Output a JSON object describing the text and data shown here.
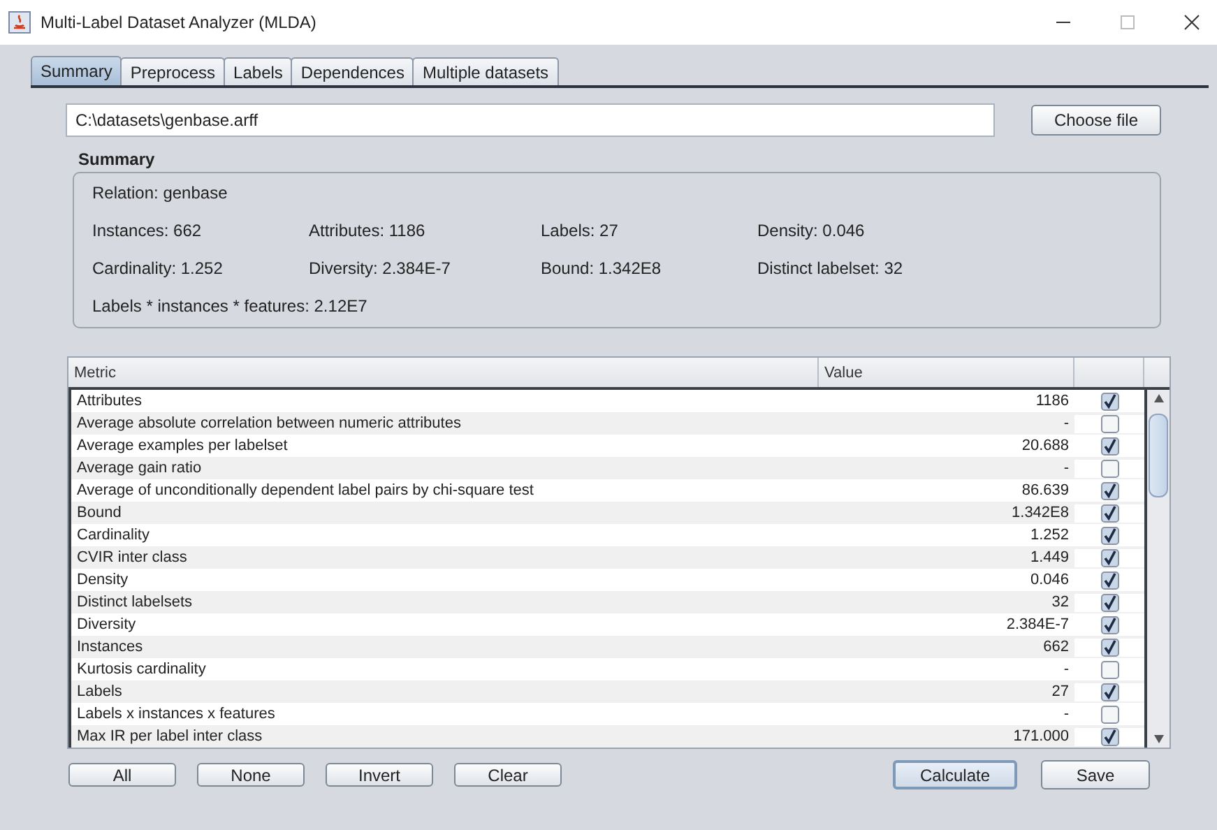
{
  "window": {
    "title": "Multi-Label Dataset Analyzer (MLDA)"
  },
  "tabs": [
    {
      "label": "Summary",
      "selected": true
    },
    {
      "label": "Preprocess",
      "selected": false
    },
    {
      "label": "Labels",
      "selected": false
    },
    {
      "label": "Dependences",
      "selected": false
    },
    {
      "label": "Multiple datasets",
      "selected": false
    }
  ],
  "file": {
    "value": "C:\\datasets\\genbase.arff",
    "button": "Choose file"
  },
  "summary": {
    "title": "Summary",
    "relation": "Relation:  genbase",
    "grid": [
      [
        "Instances:  662",
        "Attributes:  1186",
        "Labels:  27",
        "Density:  0.046"
      ],
      [
        "Cardinality:  1.252",
        "Diversity:  2.384E-7",
        "Bound:  1.342E8",
        "Distinct labelset:  32"
      ]
    ],
    "footer": "Labels * instances * features:  2.12E7"
  },
  "table": {
    "columns": [
      "Metric",
      "Value"
    ],
    "rows": [
      {
        "metric": "Attributes",
        "value": "1186",
        "checked": true
      },
      {
        "metric": "Average absolute correlation between numeric attributes",
        "value": "-",
        "checked": false
      },
      {
        "metric": "Average examples per labelset",
        "value": "20.688",
        "checked": true
      },
      {
        "metric": "Average gain ratio",
        "value": "-",
        "checked": false
      },
      {
        "metric": "Average of unconditionally dependent label pairs by chi-square test",
        "value": "86.639",
        "checked": true
      },
      {
        "metric": "Bound",
        "value": "1.342E8",
        "checked": true
      },
      {
        "metric": "Cardinality",
        "value": "1.252",
        "checked": true
      },
      {
        "metric": "CVIR inter class",
        "value": "1.449",
        "checked": true
      },
      {
        "metric": "Density",
        "value": "0.046",
        "checked": true
      },
      {
        "metric": "Distinct labelsets",
        "value": "32",
        "checked": true
      },
      {
        "metric": "Diversity",
        "value": "2.384E-7",
        "checked": true
      },
      {
        "metric": "Instances",
        "value": "662",
        "checked": true
      },
      {
        "metric": "Kurtosis cardinality",
        "value": "-",
        "checked": false
      },
      {
        "metric": "Labels",
        "value": "27",
        "checked": true
      },
      {
        "metric": "Labels x instances x features",
        "value": "-",
        "checked": false
      },
      {
        "metric": "Max IR per label inter class",
        "value": "171.000",
        "checked": true
      }
    ]
  },
  "selection_buttons": [
    "All",
    "None",
    "Invert",
    "Clear"
  ],
  "action_buttons": [
    {
      "label": "Calculate",
      "selected": true
    },
    {
      "label": "Save",
      "selected": false
    }
  ]
}
